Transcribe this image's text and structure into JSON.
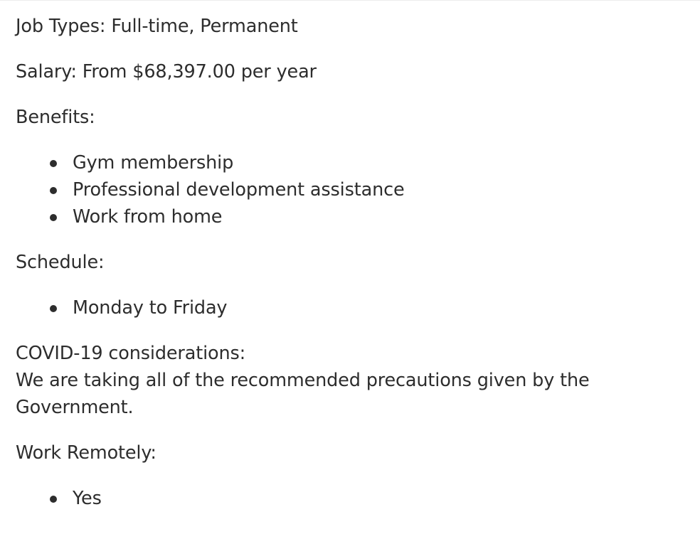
{
  "job_types": "Job Types: Full-time, Permanent",
  "salary": "Salary: From $68,397.00 per year",
  "benefits": {
    "heading": "Benefits:",
    "items": [
      "Gym membership",
      "Professional development assistance",
      "Work from home"
    ]
  },
  "schedule": {
    "heading": "Schedule:",
    "items": [
      "Monday to Friday"
    ]
  },
  "covid": {
    "heading": "COVID-19 considerations:",
    "text": "We are taking all of the recommended precautions given by the Government."
  },
  "work_remotely": {
    "heading": "Work Remotely:",
    "items": [
      "Yes"
    ]
  }
}
